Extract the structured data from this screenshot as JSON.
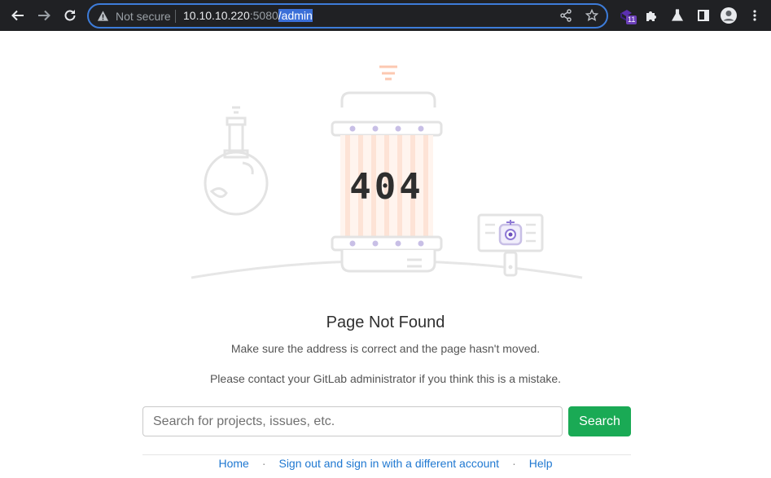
{
  "browser": {
    "not_secure_label": "Not secure",
    "url_host": "10.10.10.220",
    "url_port": ":5080",
    "url_path": "/admin",
    "extension_badge": "11",
    "icons": [
      "back-arrow-icon",
      "forward-arrow-icon",
      "reload-icon",
      "warning-icon",
      "share-icon",
      "star-icon",
      "extension-icon",
      "puzzle-icon",
      "flask-icon",
      "sidebar-icon",
      "profile-icon",
      "menu-icon"
    ]
  },
  "page": {
    "error_code": "404",
    "title": "Page Not Found",
    "message_primary": "Make sure the address is correct and the page hasn't moved.",
    "message_secondary": "Please contact your GitLab administrator if you think this is a mistake.",
    "search_placeholder": "Search for projects, issues, etc.",
    "search_button": "Search",
    "footer_links": {
      "home": "Home",
      "sign_out": "Sign out and sign in with a different account",
      "help": "Help",
      "separator": "·"
    },
    "colors": {
      "accent_green": "#1aaa55",
      "link_blue": "#1f78d1",
      "omnibox_focus": "#3d7cd9",
      "toolbar_bg": "#202124"
    }
  }
}
